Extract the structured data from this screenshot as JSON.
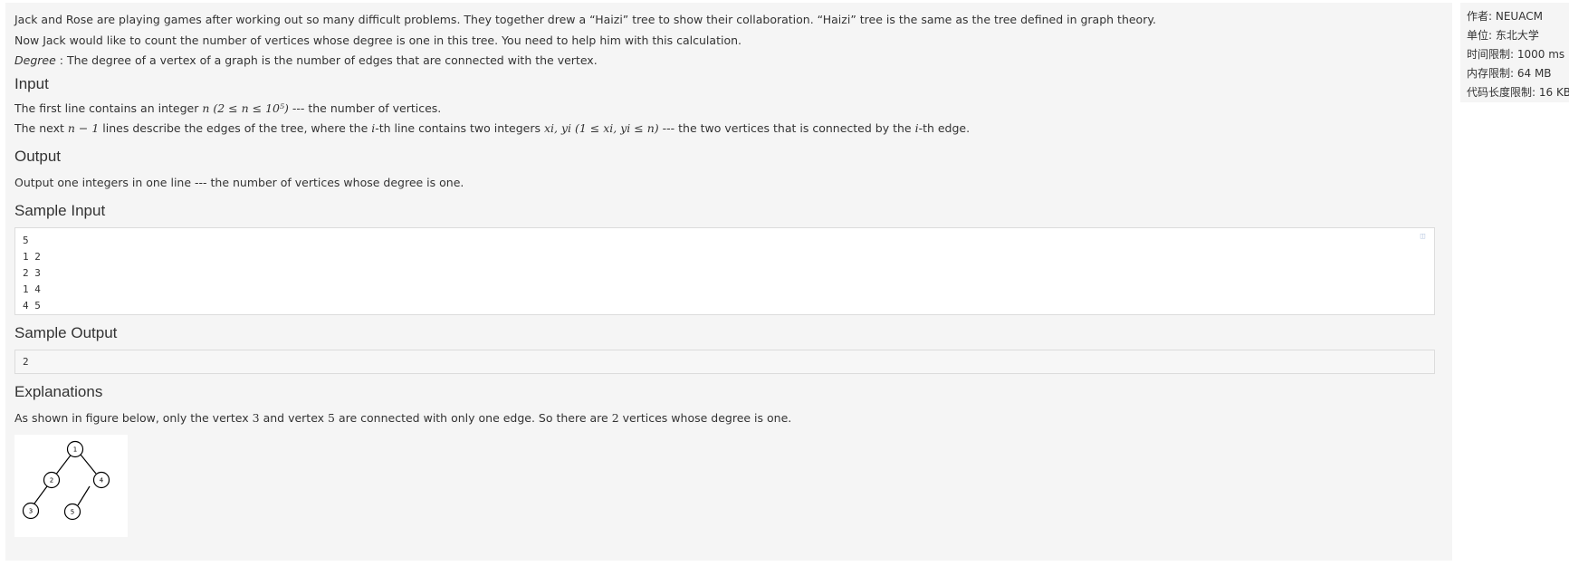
{
  "problem": {
    "intro": [
      "Jack and Rose are playing games after working out so many difficult problems. They together drew a “Haizi” tree to show their collaboration. “Haizi” tree is the same as the tree defined in graph theory.",
      "Now Jack would like to count the number of vertices whose degree is one in this tree. You need to help him with this calculation."
    ],
    "degree_term": "Degree",
    "degree_def": " : The degree of a vertex of a graph is the number of edges that are connected with the vertex.",
    "input_heading": "Input",
    "input_line1": {
      "before": "The first line contains an integer ",
      "math": "n (2 ≤ n ≤ 10⁵)",
      "after": " --- the number of vertices."
    },
    "input_line2": {
      "before": "The next ",
      "math1": "n − 1",
      "mid1": " lines describe the edges of the tree, where the ",
      "math2": "i",
      "mid2": "-th line contains two integers ",
      "math3": "xi, yi (1 ≤ xi, yi ≤ n)",
      "mid3": " --- the two vertices that is connected by the ",
      "math4": "i",
      "after": "-th edge."
    },
    "output_heading": "Output",
    "output_text": "Output one integers in one line --- the number of vertices whose degree is one.",
    "sample_input_heading": "Sample Input",
    "sample_input_lines": [
      "5",
      "1 2",
      "2 3",
      "1 4",
      "4 5"
    ],
    "sample_output_heading": "Sample Output",
    "sample_output_lines": [
      "2"
    ],
    "explanations_heading": "Explanations",
    "explanation": {
      "before": "As shown in figure below, only the vertex ",
      "v1": "3",
      "mid1": " and vertex ",
      "v2": "5",
      "mid2": " are connected with only one edge. So there are ",
      "v3": "2",
      "after": " vertices whose degree is one."
    },
    "figure_nodes": [
      "1",
      "2",
      "4",
      "3",
      "5"
    ]
  },
  "sidebar": {
    "author": "作者: NEUACM",
    "unit": "单位: 东北大学",
    "time_limit": "时间限制: 1000 ms",
    "memory_limit": "内存限制: 64 MB",
    "code_limit": "代码长度限制: 16 KB"
  },
  "icons": {
    "copy": "copy-icon"
  }
}
